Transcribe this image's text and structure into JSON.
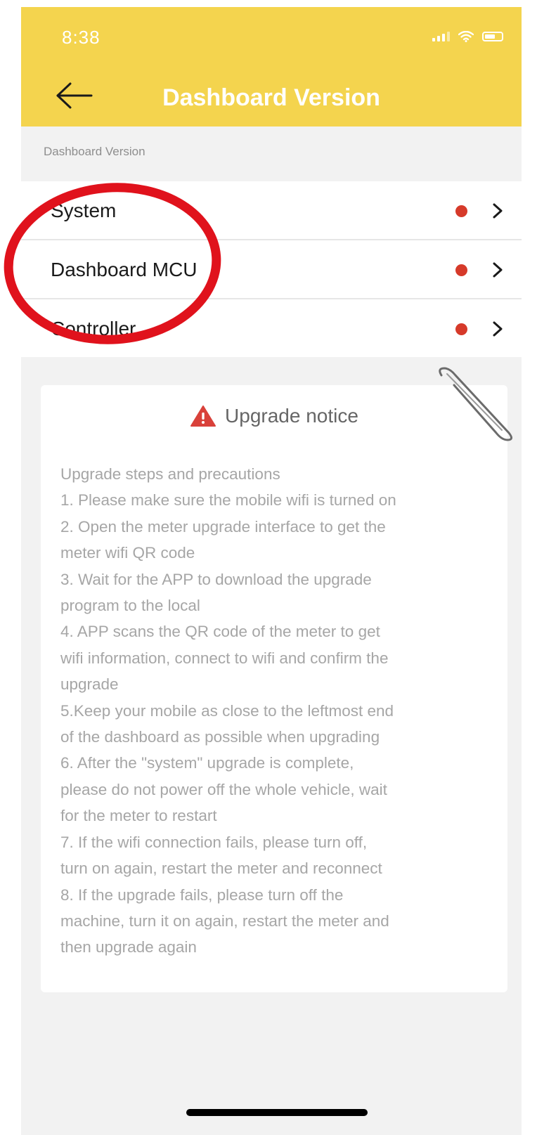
{
  "status_bar": {
    "time": "8:38"
  },
  "header": {
    "title": "Dashboard Version"
  },
  "section_label": "Dashboard Version",
  "menu_items": [
    {
      "label": "System"
    },
    {
      "label": "Dashboard MCU"
    },
    {
      "label": "Controller"
    }
  ],
  "notice": {
    "title": "Upgrade notice",
    "lines": [
      "Upgrade steps and precautions",
      "1. Please make sure the mobile wifi is turned on",
      "2. Open the meter upgrade interface to get the",
      "meter wifi QR code",
      "3. Wait for the APP to download the upgrade",
      "program to the local",
      "4. APP scans the QR code of the meter to get",
      "wifi information, connect to wifi and confirm the",
      "upgrade",
      "5.Keep your mobile as close to the leftmost end",
      "of the dashboard as possible when upgrading",
      "6. After the \"system\" upgrade is complete,",
      "please do not power off the whole vehicle, wait",
      "for the meter to restart",
      "7. If the wifi connection fails, please turn off,",
      "turn on again, restart the meter and reconnect",
      "8. If the upgrade fails, please turn off the",
      "machine, turn it on again, restart the meter and",
      "then upgrade again"
    ]
  },
  "colors": {
    "header_yellow": "#f4d44e",
    "badge_red": "#d63a2a",
    "annotation_red": "#e0121c",
    "warning_red": "#d9413a"
  },
  "icons": {
    "back": "arrow-left-icon",
    "chevron": "chevron-right-icon",
    "badge": "red-dot-badge",
    "warning": "warning-triangle-icon"
  }
}
